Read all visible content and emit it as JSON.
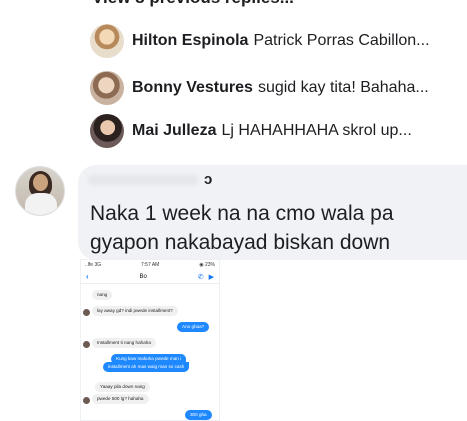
{
  "header": {
    "view_previous": "View 8 previous replies..."
  },
  "replies": [
    {
      "name": "Hilton Espinola",
      "snippet": "Patrick Porras Cabillon..."
    },
    {
      "name": "Bonny Vestures",
      "snippet": "sugid kay tita! Bahaha..."
    },
    {
      "name": "Mai Julleza",
      "snippet": "Lj HAHAHHAHA skrol up..."
    }
  ],
  "comment": {
    "name_partial": "ɔ",
    "text": "Naka 1 week na na cmo wala pa gyapon nakabayad biskan down"
  },
  "screenshot": {
    "status_left": "..lfe 3G",
    "status_time": "7:57 AM",
    "status_right": "◉ 23%",
    "title": "Bo",
    "back_icon": "‹",
    "icons": [
      "call-icon",
      "video-icon"
    ],
    "messages": [
      {
        "dir": "in",
        "text": "nang"
      },
      {
        "dir": "in",
        "text": "lay away gd? indi pwede installment?"
      },
      {
        "dir": "out",
        "text": "Ano ghaa?"
      },
      {
        "dir": "in",
        "text": "Installment ti nang hahaha"
      },
      {
        "dir": "out",
        "text": "Kung kaw makuha pwede man i"
      },
      {
        "dir": "out",
        "text": "installment ah mas waig man so cash"
      },
      {
        "dir": "in",
        "text": "Yaaay pila down nang"
      },
      {
        "dir": "in",
        "text": "pwede 500 lg? hahaha"
      },
      {
        "dir": "out",
        "text": "300 gha"
      }
    ]
  }
}
